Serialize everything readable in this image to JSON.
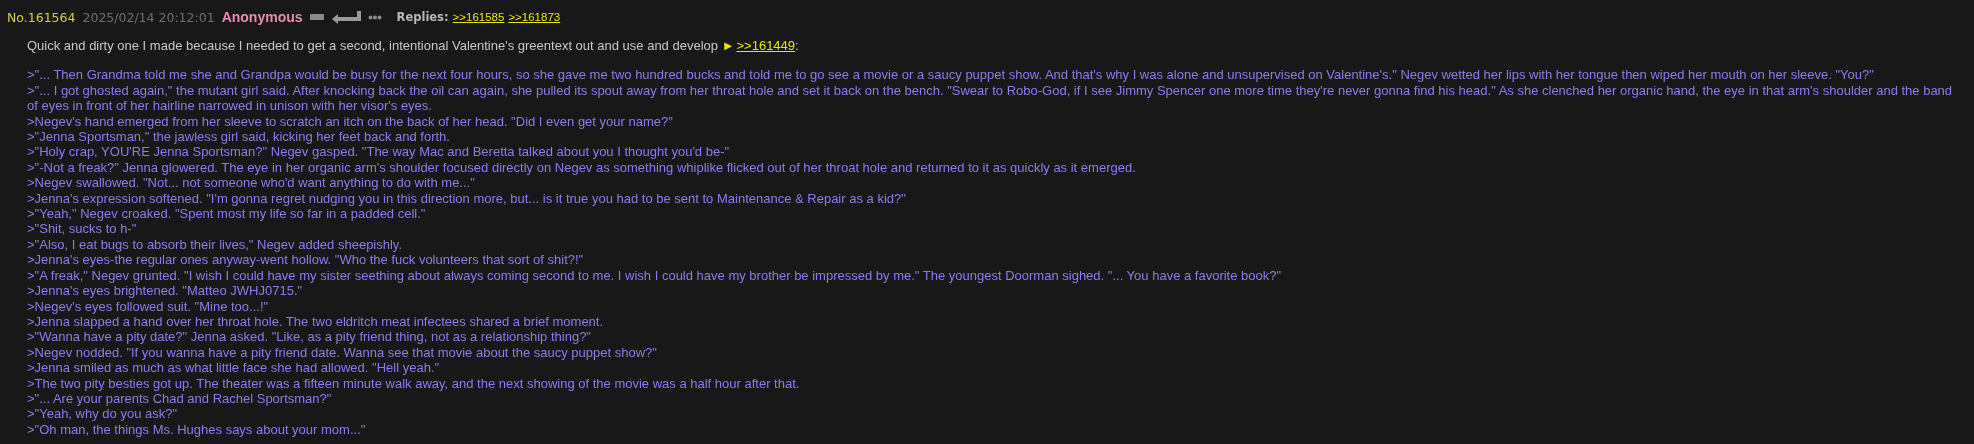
{
  "post": {
    "number": "No.161564",
    "date": "2025/02/14 20:12:01",
    "name": "Anonymous",
    "replies_label": "Replies:",
    "replies": [
      ">>161585",
      ">>161873"
    ],
    "intro": {
      "text": "Quick and dirty one I made because I needed to get a second, intentional Valentine's greentext out and use and develop ",
      "link_arrow": "►",
      "link": ">>161449",
      "after": ":"
    },
    "lines": [
      ">\"... Then Grandma told me she and Grandpa would be busy for the next four hours, so she gave me two hundred bucks and told me to go see a movie or a saucy puppet show. And that's why I was alone and unsupervised on Valentine's.\" Negev wetted her lips with her tongue then wiped her mouth on her sleeve. \"You?\"",
      ">\"... I got ghosted again,\" the mutant girl said. After knocking back the oil can again, she pulled its spout away from her throat hole and set it back on the bench. \"Swear to Robo-God, if I see Jimmy Spencer one more time they're never gonna find his head.\" As she clenched her organic hand, the eye in that arm's shoulder and the band of eyes in front of her hairline narrowed in unison with her visor's eyes.",
      ">Negev's hand emerged from her sleeve to scratch an itch on the back of her head. \"Did I even get your name?\"",
      ">\"Jenna Sportsman,\" the jawless girl said, kicking her feet back and forth.",
      ">\"Holy crap, YOU'RE Jenna Sportsman?\" Negev gasped. \"The way Mac and Beretta talked about you I thought you'd be-\"",
      ">\"-Not a freak?\" Jenna glowered. The eye in her organic arm's shoulder focused directly on Negev as something whiplike flicked out of her throat hole and returned to it as quickly as it emerged.",
      ">Negev swallowed. \"Not... not someone who'd want anything to do with me...\"",
      ">Jenna's expression softened. \"I'm gonna regret nudging you in this direction more, but... is it true you had to be sent to Maintenance & Repair as a kid?\"",
      ">\"Yeah,\" Negev croaked. \"Spent most my life so far in a padded cell.\"",
      ">\"Shit, sucks to h-\"",
      ">\"Also, I eat bugs to absorb their lives,\" Negev added sheepishly.",
      ">Jenna's eyes-the regular ones anyway-went hollow. \"Who the fuck volunteers that sort of shit?!\"",
      ">\"A freak,\" Negev grunted. \"I wish I could have my sister seething about always coming second to me. I wish I could have my brother be impressed by me.\" The youngest Doorman sighed. \"... You have a favorite book?\"",
      ">Jenna's eyes brightened. \"Matteo JWHJ0715.\"",
      ">Negev's eyes followed suit. \"Mine too...!\"",
      ">Jenna slapped a hand over her throat hole. The two eldritch meat infectees shared a brief moment.",
      ">\"Wanna have a pity date?\" Jenna asked. \"Like, as a pity friend thing, not as a relationship thing?\"",
      ">Negev nodded. \"If you wanna have a pity friend date. Wanna see that movie about the saucy puppet show?\"",
      ">Jenna smiled as much as what little face she had allowed. \"Hell yeah.\"",
      ">The two pity besties got up. The theater was a fifteen minute walk away, and the next showing of the movie was a half hour after that.",
      ">\"... Are your parents Chad and Rachel Sportsman?\"",
      ">\"Yeah, why do you ask?\"",
      ">\"Oh man, the things Ms. Hughes says about your mom...\""
    ]
  }
}
